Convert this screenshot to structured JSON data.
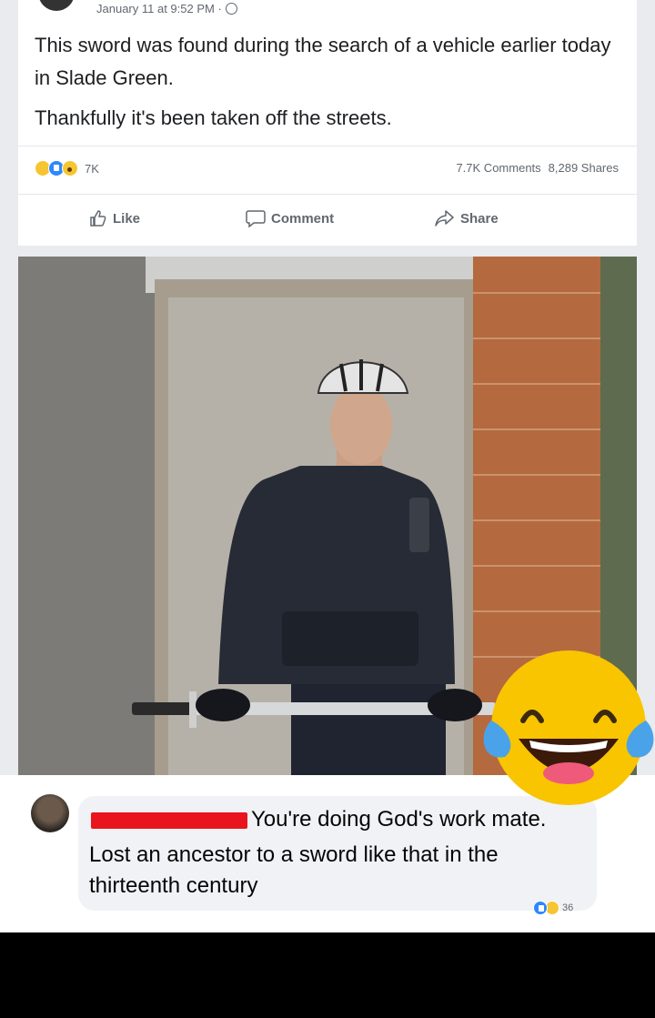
{
  "post": {
    "timestamp": "January 11 at 9:52 PM ·",
    "privacy_icon": "globe-icon",
    "text_line1": "This sword was found during the search of a vehicle earlier today in Slade Green.",
    "text_line2": "Thankfully it's been taken off the streets.",
    "reaction_count": "7K",
    "comments_count": "7.7K Comments",
    "shares_count": "8,289 Shares",
    "actions": {
      "like": "Like",
      "comment": "Comment",
      "share": "Share"
    }
  },
  "comment": {
    "text_line1": "You're doing God's work mate.",
    "text_line2": "Lost an ancestor to a sword like that in the thirteenth century",
    "reaction_count": "36"
  },
  "colors": {
    "facebook_blue": "#2d88ff",
    "redaction": "#e8141e",
    "haha_yellow": "#f7c531"
  }
}
